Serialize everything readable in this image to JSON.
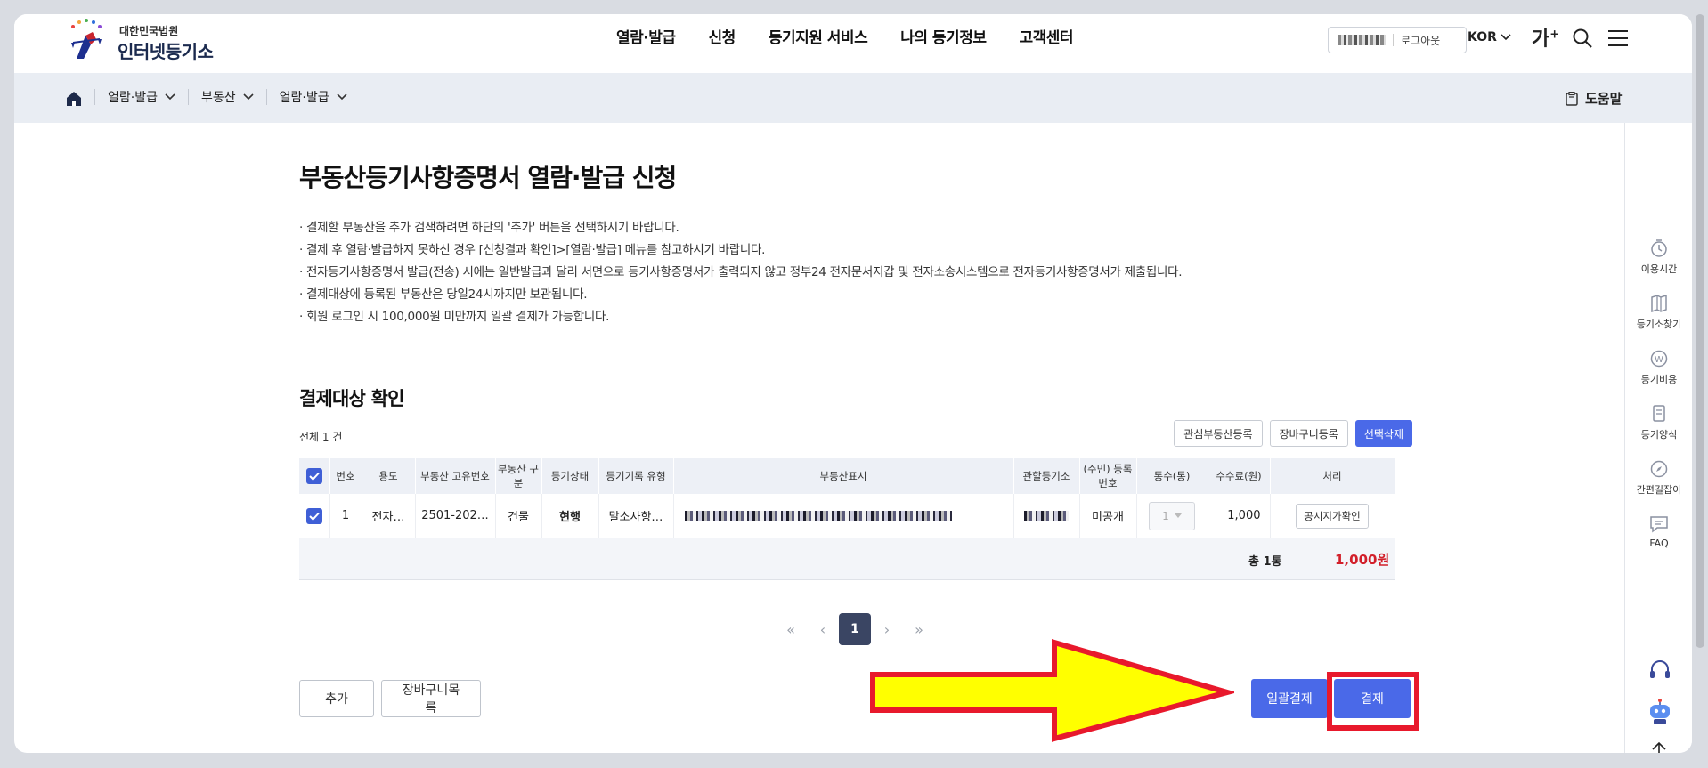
{
  "header": {
    "logo_small": "대한민국법원",
    "logo_big": "인터넷등기소",
    "nav": [
      "열람·발급",
      "신청",
      "등기지원 서비스",
      "나의 등기정보",
      "고객센터"
    ],
    "logout": "로그아웃",
    "lang": "KOR",
    "font_size_label": "가",
    "font_size_plus": "+"
  },
  "breadcrumb": {
    "items": [
      "열람·발급",
      "부동산",
      "열람·발급"
    ],
    "help": "도움말"
  },
  "quick_menu": [
    "이용시간",
    "등기소찾기",
    "등기비용",
    "등기양식",
    "간편길잡이",
    "FAQ"
  ],
  "page": {
    "title": "부동산등기사항증명서 열람·발급 신청",
    "notes": [
      "· 결제할 부동산을 추가 검색하려면 하단의 '추가' 버튼을 선택하시기 바랍니다.",
      "· 결제 후 열람·발급하지 못하신 경우 [신청결과 확인]>[열람·발급] 메뉴를 참고하시기 바랍니다.",
      "· 전자등기사항증명서 발급(전송) 시에는 일반발급과 달리 서면으로 등기사항증명서가 출력되지 않고 정부24 전자문서지갑 및 전자소송시스템으로 전자등기사항증명서가 제출됩니다.",
      "· 결제대상에 등록된 부동산은 당일24시까지만 보관됩니다.",
      "· 회원 로그인 시 100,000원 미만까지 일괄 결제가 가능합니다."
    ],
    "section_title": "결제대상 확인",
    "total": "전체 1 건"
  },
  "table": {
    "buttons": [
      "관심부동산등록",
      "장바구니등록",
      "선택삭제"
    ],
    "headers": {
      "no": "번호",
      "use": "용도",
      "uid": "부동산 고유번호",
      "type": "부동산 구분",
      "state": "등기상태",
      "rec": "등기기록 유형",
      "desc": "부동산표시",
      "office": "관할등기소",
      "regno": "(주민) 등록번호",
      "qty": "통수(통)",
      "fee": "수수료(원)",
      "act": "처리"
    },
    "rows": [
      {
        "no": "1",
        "use": "전자…",
        "uid": "2501-202…",
        "type": "건물",
        "state": "현행",
        "rec": "말소사항…",
        "regno": "미공개",
        "qty": "1",
        "fee": "1,000",
        "action": "공시지가확인"
      }
    ],
    "sum_count": "총 1통",
    "sum_amount": "1,000원"
  },
  "pager": {
    "first": "«",
    "prev": "‹",
    "current": "1",
    "next": "›",
    "last": "»"
  },
  "actions": {
    "add": "추가",
    "cart_list": "장바구니목록",
    "bulk_pay": "일괄결제",
    "pay": "결제"
  },
  "colors": {
    "accent": "#4a69e8",
    "highlight_frame": "#e8192c",
    "arrow_fill": "#ffff00",
    "amount_red": "#d21f2a"
  }
}
